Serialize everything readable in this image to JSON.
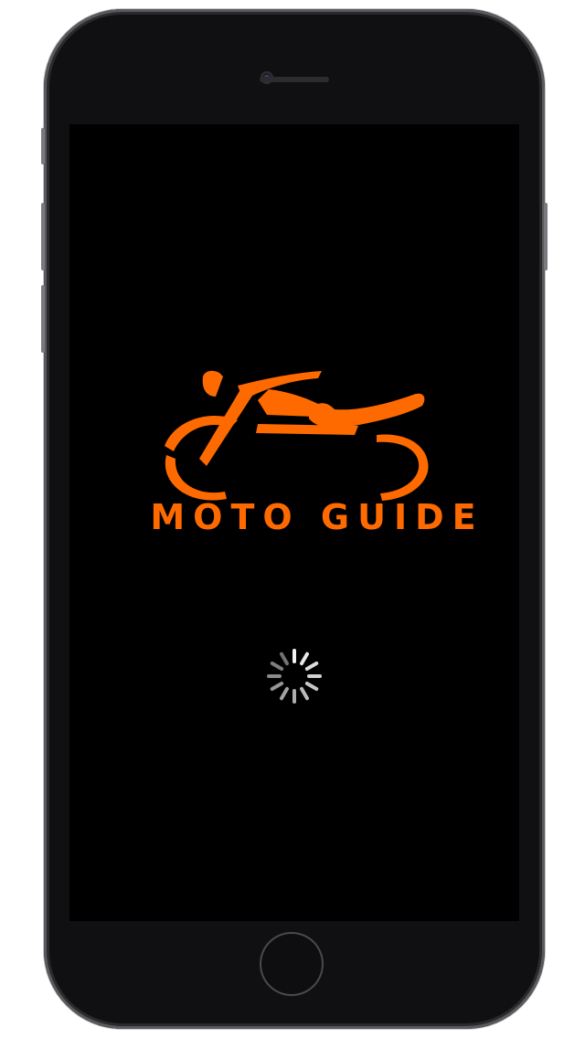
{
  "app": {
    "name": "MOTO GUIDE",
    "logo_icon": "motorcycle-icon",
    "brand_color": "#ff6a00",
    "background_color": "#000000"
  },
  "loading": {
    "icon": "activity-spinner-icon"
  }
}
